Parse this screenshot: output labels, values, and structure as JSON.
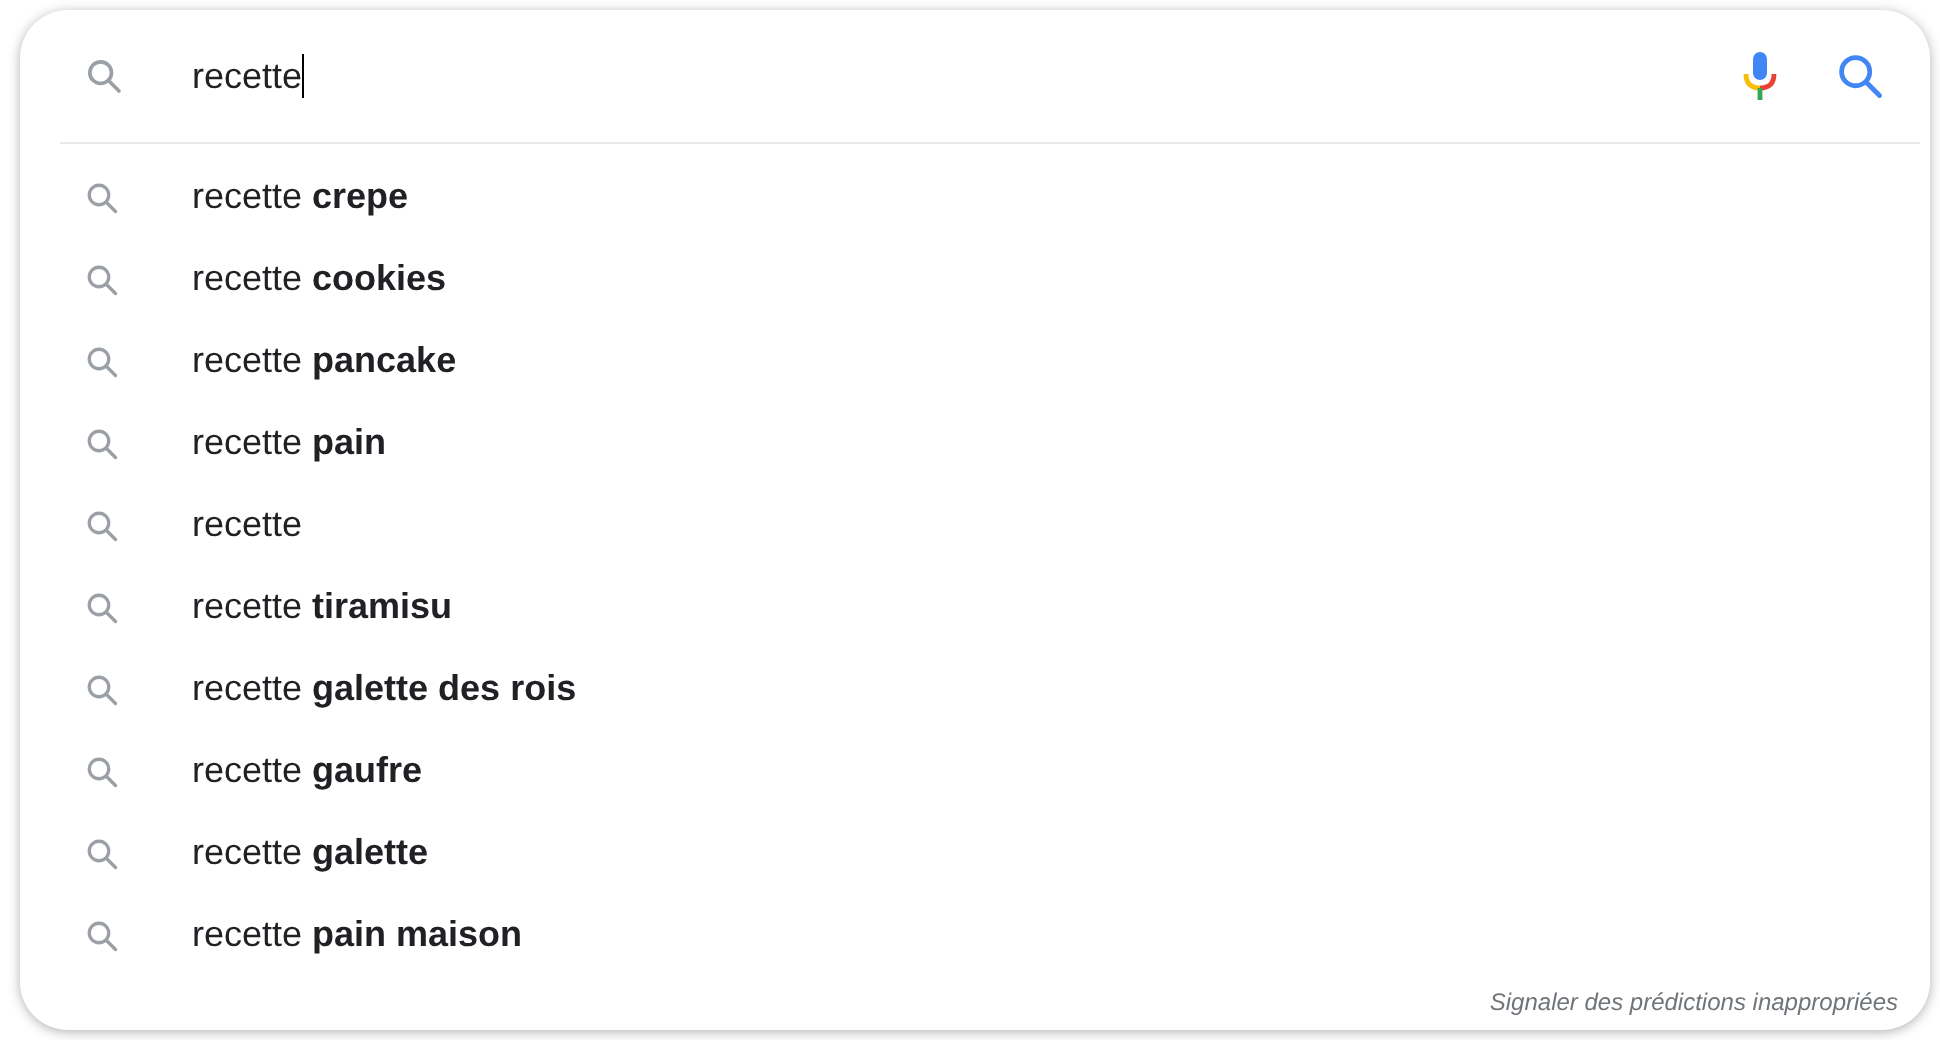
{
  "search": {
    "value": "recette"
  },
  "suggestions": [
    {
      "text": "recette **crepe**"
    },
    {
      "text": "recette **cookies**"
    },
    {
      "text": "recette **pancake**"
    },
    {
      "text": "recette **pain**"
    },
    {
      "text": "recette"
    },
    {
      "text": "recette **tiramisu**"
    },
    {
      "text": "recette **galette des rois**"
    },
    {
      "text": "recette **gaufre**"
    },
    {
      "text": "recette **galette**"
    },
    {
      "text": "recette **pain maison**"
    }
  ],
  "footer_link": "Signaler des prédictions inappropriées"
}
